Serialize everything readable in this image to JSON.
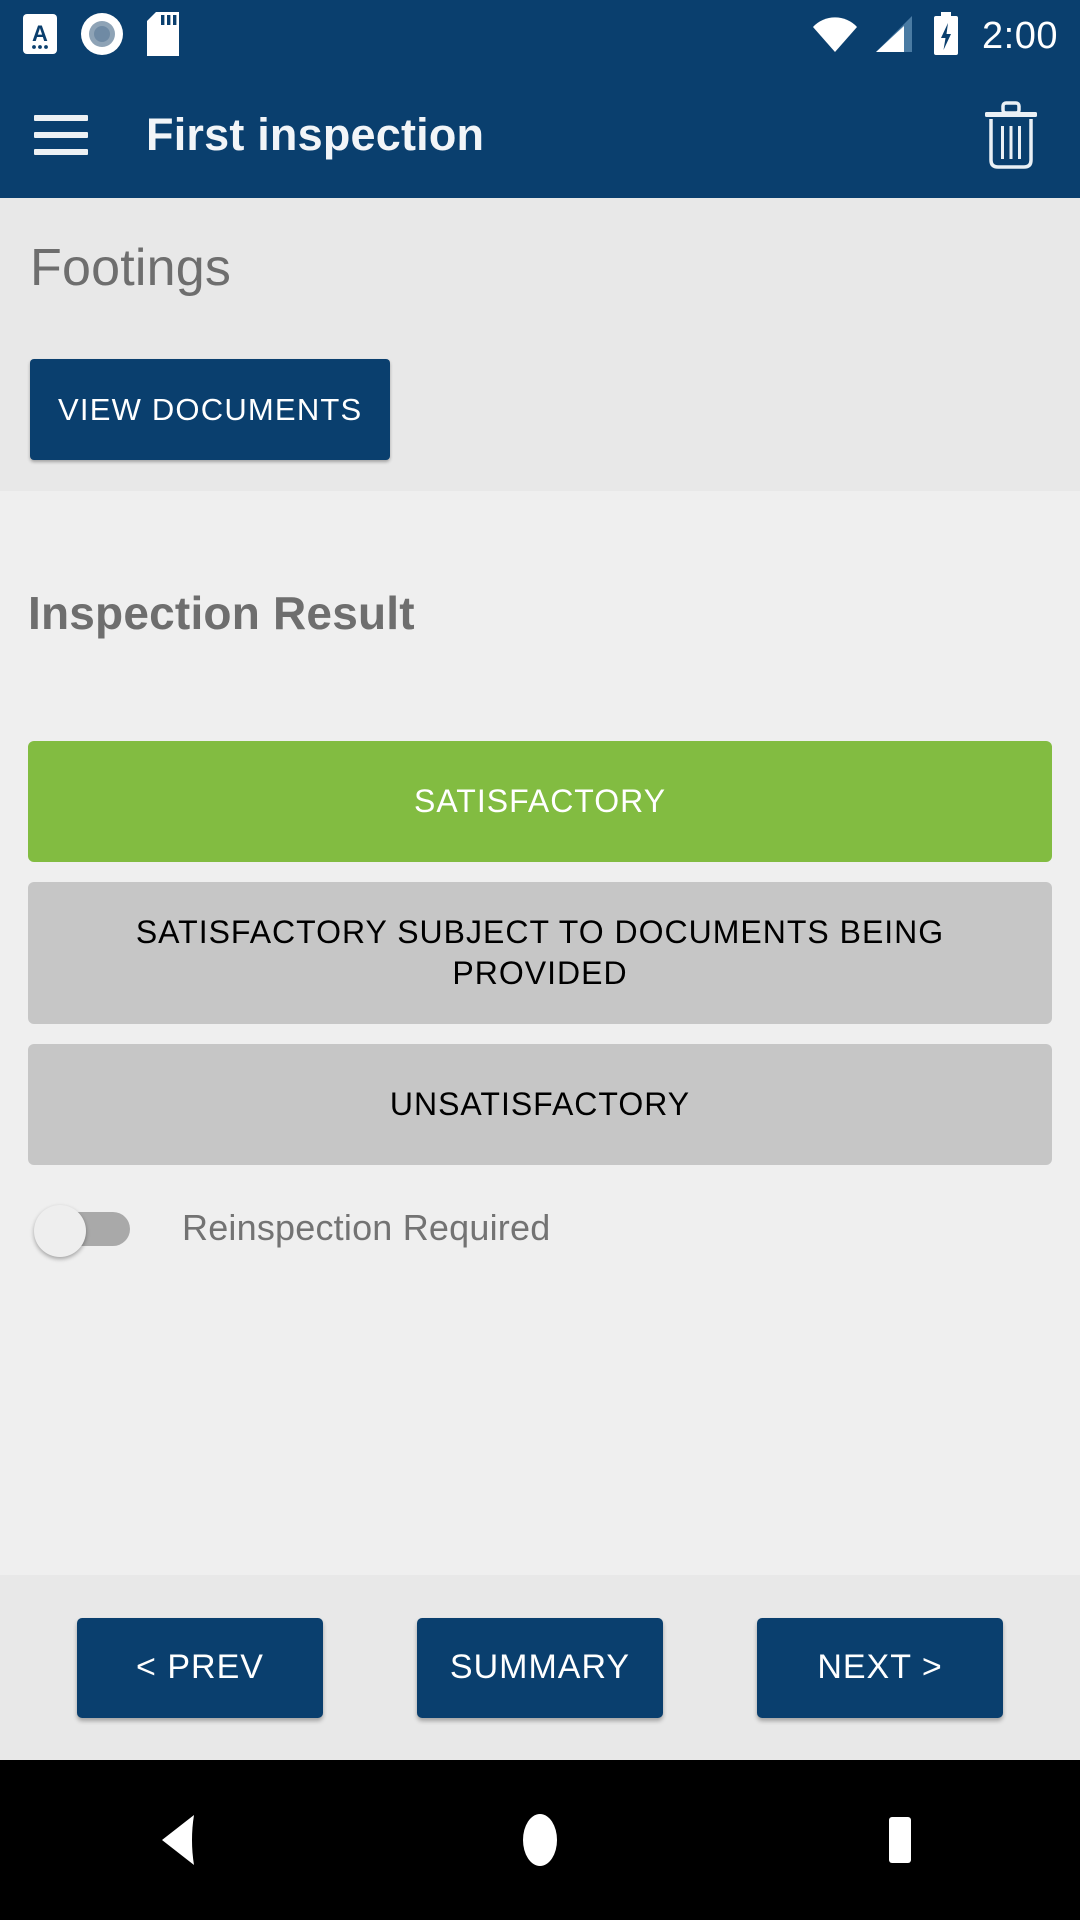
{
  "status_bar": {
    "time": "2:00",
    "left_icons": [
      "keyboard-a-icon",
      "screen-record-icon",
      "sd-card-icon"
    ],
    "right_icons": [
      "wifi-icon",
      "cellular-signal-icon",
      "battery-charging-icon"
    ],
    "background": "#0a3f6e"
  },
  "app_bar": {
    "menu_icon": "hamburger-menu-icon",
    "title": "First inspection",
    "action_icon": "trash-delete-icon",
    "background": "#0a3f6e"
  },
  "footings_section": {
    "title": "Footings",
    "view_documents_label": "VIEW DOCUMENTS",
    "background": "#e8e8e8",
    "button_color": "#0a3f6e"
  },
  "result_section": {
    "title": "Inspection Result",
    "background": "#efefef",
    "selected_color": "#82bc41",
    "unselected_color": "#c6c6c6",
    "options": [
      {
        "label": "SATISFACTORY",
        "selected": true
      },
      {
        "label": "SATISFACTORY SUBJECT TO DOCUMENTS BEING PROVIDED",
        "selected": false
      },
      {
        "label": "UNSATISFACTORY",
        "selected": false
      }
    ],
    "toggle": {
      "label": "Reinspection Required",
      "state": "off"
    }
  },
  "footer_nav": {
    "background": "#e8e8e8",
    "prev_label": "< PREV",
    "summary_label": "SUMMARY",
    "next_label": "NEXT >",
    "button_color": "#0a3f6e"
  },
  "android_nav": {
    "background": "#000000",
    "back_icon": "back-triangle-icon",
    "home_icon": "home-circle-icon",
    "recents_icon": "recents-square-icon"
  }
}
